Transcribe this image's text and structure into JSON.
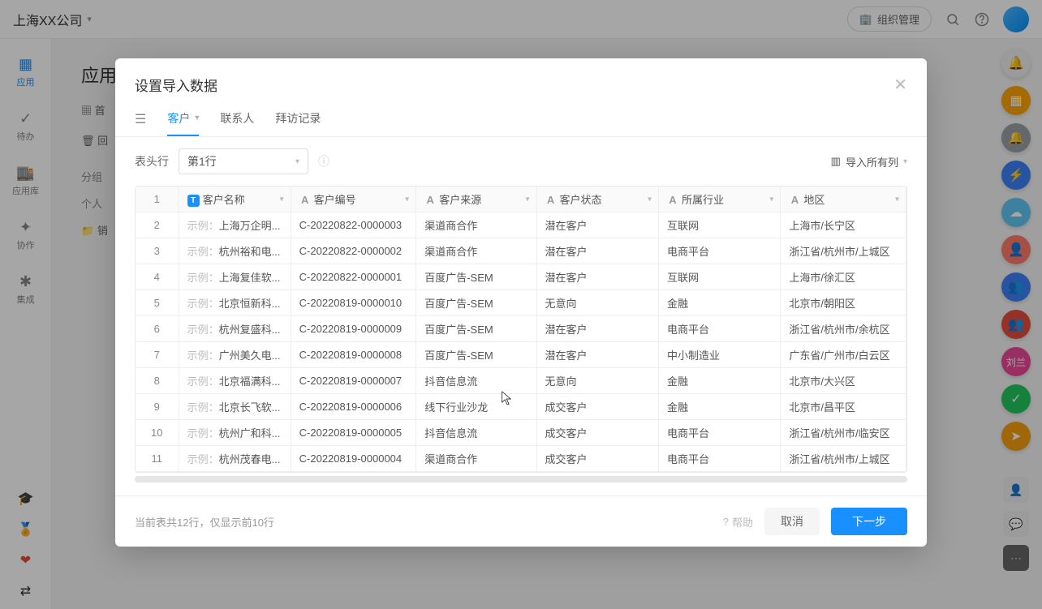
{
  "header": {
    "company": "上海XX公司",
    "org_button": "组织管理"
  },
  "sidebar": {
    "items": [
      {
        "icon": "▦",
        "label": "应用"
      },
      {
        "icon": "✓",
        "label": "待办"
      },
      {
        "icon": "🏬",
        "label": "应用库"
      },
      {
        "icon": "✦",
        "label": "协作"
      },
      {
        "icon": "✱",
        "label": "集成"
      }
    ],
    "bottom_icons": [
      "🎓",
      "🏅",
      "❤",
      "⇄"
    ]
  },
  "page": {
    "title": "应用",
    "crumb1": "首",
    "crumb2": "回",
    "group_label": "分组",
    "personal_label": "个人",
    "sale_label": "销"
  },
  "right_circles": [
    {
      "cls": "rb-gray",
      "glyph": "🔔"
    },
    {
      "cls": "rb-orange",
      "glyph": "▦"
    },
    {
      "cls": "rb-darkgray",
      "glyph": "🔔"
    },
    {
      "cls": "rb-blue",
      "glyph": "⚡"
    },
    {
      "cls": "rb-sky",
      "glyph": "☁"
    },
    {
      "cls": "rb-salmon",
      "glyph": "👤"
    },
    {
      "cls": "rb-blue",
      "glyph": "👥"
    },
    {
      "cls": "rb-red",
      "glyph": "👥"
    },
    {
      "cls": "rb-pink",
      "glyph": "刘兰"
    },
    {
      "cls": "rb-green",
      "glyph": "✓"
    },
    {
      "cls": "rb-teal",
      "glyph": "➤"
    }
  ],
  "modal": {
    "title": "设置导入数据",
    "tabs": [
      "客户",
      "联系人",
      "拜访记录"
    ],
    "header_row_label": "表头行",
    "header_row_value": "第1行",
    "import_all_columns": "导入所有列",
    "columns": [
      {
        "key": "name",
        "label": "客户名称",
        "title_icon": "T"
      },
      {
        "key": "code",
        "label": "客户编号"
      },
      {
        "key": "source",
        "label": "客户来源"
      },
      {
        "key": "status",
        "label": "客户状态"
      },
      {
        "key": "industry",
        "label": "所属行业"
      },
      {
        "key": "region",
        "label": "地区"
      }
    ],
    "example_prefix": "示例：",
    "rows": [
      {
        "name": "上海万企明...",
        "code": "C-20220822-0000003",
        "source": "渠道商合作",
        "status": "潜在客户",
        "industry": "互联网",
        "region": "上海市/长宁区"
      },
      {
        "name": "杭州裕和电...",
        "code": "C-20220822-0000002",
        "source": "渠道商合作",
        "status": "潜在客户",
        "industry": "电商平台",
        "region": "浙江省/杭州市/上城区"
      },
      {
        "name": "上海复佳软...",
        "code": "C-20220822-0000001",
        "source": "百度广告-SEM",
        "status": "潜在客户",
        "industry": "互联网",
        "region": "上海市/徐汇区"
      },
      {
        "name": "北京恒新科...",
        "code": "C-20220819-0000010",
        "source": "百度广告-SEM",
        "status": "无意向",
        "industry": "金融",
        "region": "北京市/朝阳区"
      },
      {
        "name": "杭州复盛科...",
        "code": "C-20220819-0000009",
        "source": "百度广告-SEM",
        "status": "潜在客户",
        "industry": "电商平台",
        "region": "浙江省/杭州市/余杭区"
      },
      {
        "name": "广州美久电...",
        "code": "C-20220819-0000008",
        "source": "百度广告-SEM",
        "status": "潜在客户",
        "industry": "中小制造业",
        "region": "广东省/广州市/白云区"
      },
      {
        "name": "北京福满科...",
        "code": "C-20220819-0000007",
        "source": "抖音信息流",
        "status": "无意向",
        "industry": "金融",
        "region": "北京市/大兴区"
      },
      {
        "name": "北京长飞软...",
        "code": "C-20220819-0000006",
        "source": "线下行业沙龙",
        "status": "成交客户",
        "industry": "金融",
        "region": "北京市/昌平区"
      },
      {
        "name": "杭州广和科...",
        "code": "C-20220819-0000005",
        "source": "抖音信息流",
        "status": "成交客户",
        "industry": "电商平台",
        "region": "浙江省/杭州市/临安区"
      },
      {
        "name": "杭州茂春电...",
        "code": "C-20220819-0000004",
        "source": "渠道商合作",
        "status": "成交客户",
        "industry": "电商平台",
        "region": "浙江省/杭州市/上城区"
      }
    ],
    "footer_info": "当前表共12行，仅显示前10行",
    "help_label": "帮助",
    "cancel_label": "取消",
    "next_label": "下一步"
  }
}
